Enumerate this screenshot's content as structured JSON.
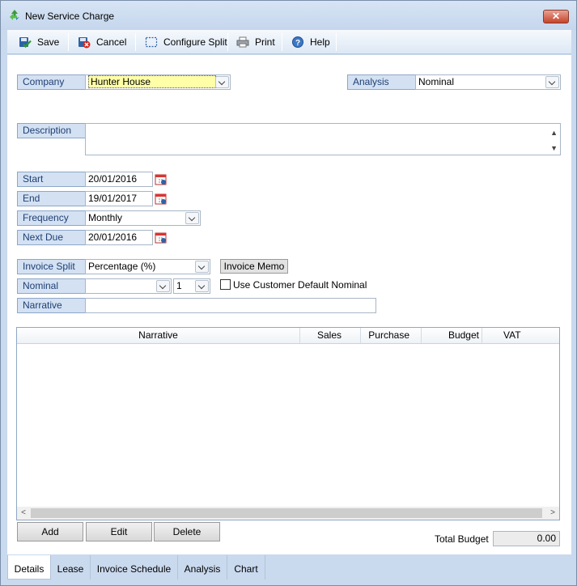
{
  "window": {
    "title": "New Service Charge",
    "close_label": "✕"
  },
  "toolbar": {
    "save": "Save",
    "cancel": "Cancel",
    "configure_split": "Configure Split",
    "print": "Print",
    "help": "Help"
  },
  "form": {
    "company_label": "Company",
    "company_value": "Hunter House",
    "analysis_label": "Analysis",
    "analysis_value": "Nominal",
    "description_label": "Description",
    "description_value": "",
    "start_label": "Start",
    "start_value": "20/01/2016",
    "end_label": "End",
    "end_value": "19/01/2017",
    "frequency_label": "Frequency",
    "frequency_value": "Monthly",
    "next_due_label": "Next Due",
    "next_due_value": "20/01/2016",
    "invoice_split_label": "Invoice Split",
    "invoice_split_value": "Percentage (%)",
    "invoice_memo_button": "Invoice Memo",
    "nominal_label": "Nominal",
    "nominal_value": "",
    "nominal_number": "1",
    "use_default_nominal_label": "Use Customer Default Nominal",
    "use_default_nominal_checked": false,
    "narrative_label": "Narrative",
    "narrative_value": ""
  },
  "grid": {
    "columns": [
      "Narrative",
      "Sales",
      "Purchase",
      "Budget",
      "VAT"
    ],
    "rows": []
  },
  "actions": {
    "add": "Add",
    "edit": "Edit",
    "delete": "Delete"
  },
  "totals": {
    "total_budget_label": "Total Budget",
    "total_budget_value": "0.00"
  },
  "tabs": [
    "Details",
    "Lease",
    "Invoice Schedule",
    "Analysis",
    "Chart"
  ],
  "active_tab": "Details",
  "colors": {
    "company_highlight": "#ffffa8",
    "label_bg": "#d3e1f3",
    "label_text": "#1f3f73"
  }
}
